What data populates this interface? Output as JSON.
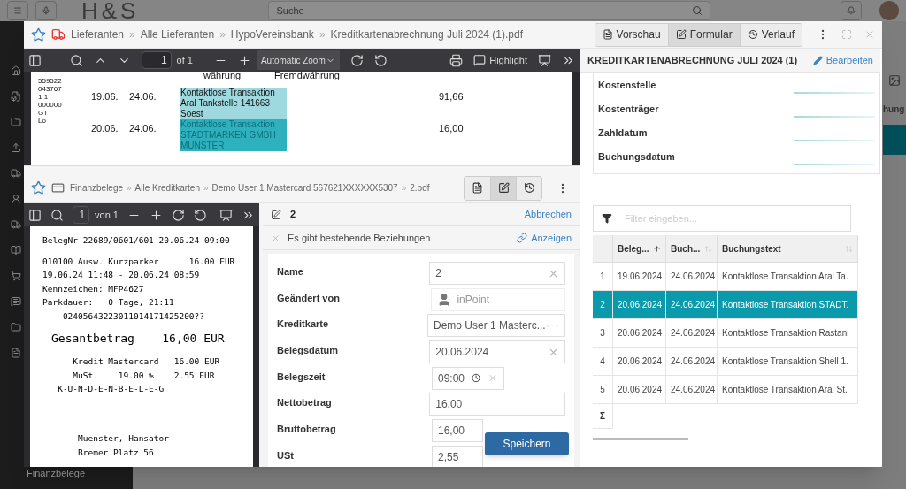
{
  "app": {
    "logo": "H&S",
    "search_placeholder": "Suche",
    "sidebar_label": "Finanzbelege",
    "peek_text": "hung"
  },
  "dialog": {
    "separator": "»",
    "breadcrumb": [
      "Lieferanten",
      "Alle Lieferanten",
      "HypoVereinsbank",
      "Kreditkartenabrechnung Juli 2024 (1).pdf"
    ],
    "view_buttons": [
      {
        "label": "Vorschau",
        "kind": "preview",
        "selected": false
      },
      {
        "label": "Formular",
        "kind": "form",
        "selected": true
      },
      {
        "label": "Verlauf",
        "kind": "history",
        "selected": false
      }
    ]
  },
  "pdf_viewer": {
    "page": "1",
    "page_count": "of 1",
    "zoom": "Automatic Zoom",
    "highlight_label": "Highlight",
    "side_codes": [
      "559522",
      "043767",
      "1 1",
      "000000",
      "GT",
      "Lo"
    ],
    "headers": [
      "währung",
      "Fremdwährung"
    ],
    "rows": [
      {
        "date": "19.06.",
        "booked": "24.06.",
        "text": "Kontaktlose Transaktion Aral Tankstelle 141663 Soest",
        "amount": "91,66",
        "selected": false
      },
      {
        "date": "20.06.",
        "booked": "24.06.",
        "text": "Kontaktlose Transaktion STADTMARKEN GMBH MÜNSTER",
        "amount": "16,00",
        "selected": true
      }
    ]
  },
  "document": {
    "breadcrumb": [
      "Finanzbelege",
      "Alle Kreditkarten",
      "Demo User 1 Mastercard 567621XXXXXX5307",
      "2.pdf"
    ],
    "view_buttons": [
      {
        "kind": "preview",
        "selected": false
      },
      {
        "kind": "form",
        "selected": true
      },
      {
        "kind": "history",
        "selected": false
      }
    ],
    "viewer": {
      "page": "1",
      "page_count": "von 1"
    },
    "receipt": [
      {
        "text": "BelegNr 22689/0601/601 20.06.24 09:00",
        "kind": "line"
      },
      {
        "text": "010100 Ausw. Kurzparker      16.00 EUR",
        "kind": "line"
      },
      {
        "text": "19.06.24 11:48 - 20.06.24 08:59",
        "kind": "line"
      },
      {
        "text": "Kennzeichen: MFP4627",
        "kind": "line"
      },
      {
        "text": "Parkdauer:   0 Tage, 21:11",
        "kind": "line"
      },
      {
        "text": "    02405643223011014171425200??",
        "kind": "line"
      },
      {
        "text": "Gesantbetrag    16,00 EUR",
        "kind": "big"
      },
      {
        "text": "      Kredit Mastercard   16.00 EUR",
        "kind": "line"
      },
      {
        "text": "      MuSt.    19.00 %    2.55 EUR",
        "kind": "line"
      },
      {
        "text": "   K-U-N-D-E-N-B-E-L-E-G",
        "kind": "line"
      },
      {
        "text": "Muenster, Hansator",
        "kind": "footer"
      },
      {
        "text": "Bremer Platz 56",
        "kind": "footer"
      }
    ]
  },
  "form": {
    "title": "2",
    "cancel": "Abbrechen",
    "notice": "Es gibt bestehende Beziehungen",
    "notice_link": "Anzeigen",
    "save": "Speichern",
    "fields": [
      {
        "label": "Name",
        "value": "2",
        "kind": "text"
      },
      {
        "label": "Geändert von",
        "value": "inPoint",
        "kind": "user"
      },
      {
        "label": "Kreditkarte",
        "value": "Demo User 1 Masterc...",
        "kind": "select"
      },
      {
        "label": "Belegsdatum",
        "value": "20.06.2024",
        "kind": "text"
      },
      {
        "label": "Belegszeit",
        "value": "09:00",
        "kind": "time"
      },
      {
        "label": "Nettobetrag",
        "value": "16,00",
        "kind": "plain"
      },
      {
        "label": "Bruttobetrag",
        "value": "16,00",
        "kind": "plain"
      },
      {
        "label": "USt",
        "value": "2,55",
        "kind": "plain"
      }
    ]
  },
  "properties": {
    "title": "KREDITKARTENABRECHNUNG JULI 2024 (1)",
    "edit": "Bearbeiten",
    "labels": [
      "Kostenstelle",
      "Kostenträger",
      "Zahldatum",
      "Buchungsdatum"
    ],
    "filter_placeholder": "Filter eingeben...",
    "columns": [
      {
        "label": "Beleg...",
        "sorted": true
      },
      {
        "label": "Buch...",
        "sorted": false
      },
      {
        "label": "Buchungstext",
        "sorted": false
      }
    ],
    "rows": [
      {
        "index": "1",
        "cells": [
          "19.06.2024",
          "24.06.2024",
          "Kontaktlose Transaktion Aral Ta."
        ],
        "selected": false
      },
      {
        "index": "2",
        "cells": [
          "20.06.2024",
          "24.06.2024",
          "Kontaktlose Transaktion STADT."
        ],
        "selected": true
      },
      {
        "index": "3",
        "cells": [
          "20.06.2024",
          "24.06.2024",
          "Kontaktlose Transaktion Rastanl"
        ],
        "selected": false
      },
      {
        "index": "4",
        "cells": [
          "20.06.2024",
          "24.06.2024",
          "Kontaktlose Transaktion Shell 1."
        ],
        "selected": false
      },
      {
        "index": "5",
        "cells": [
          "20.06.2024",
          "24.06.2024",
          "Kontaktlose Transaktion Aral St."
        ],
        "selected": false
      }
    ],
    "sum_symbol": "Σ"
  }
}
